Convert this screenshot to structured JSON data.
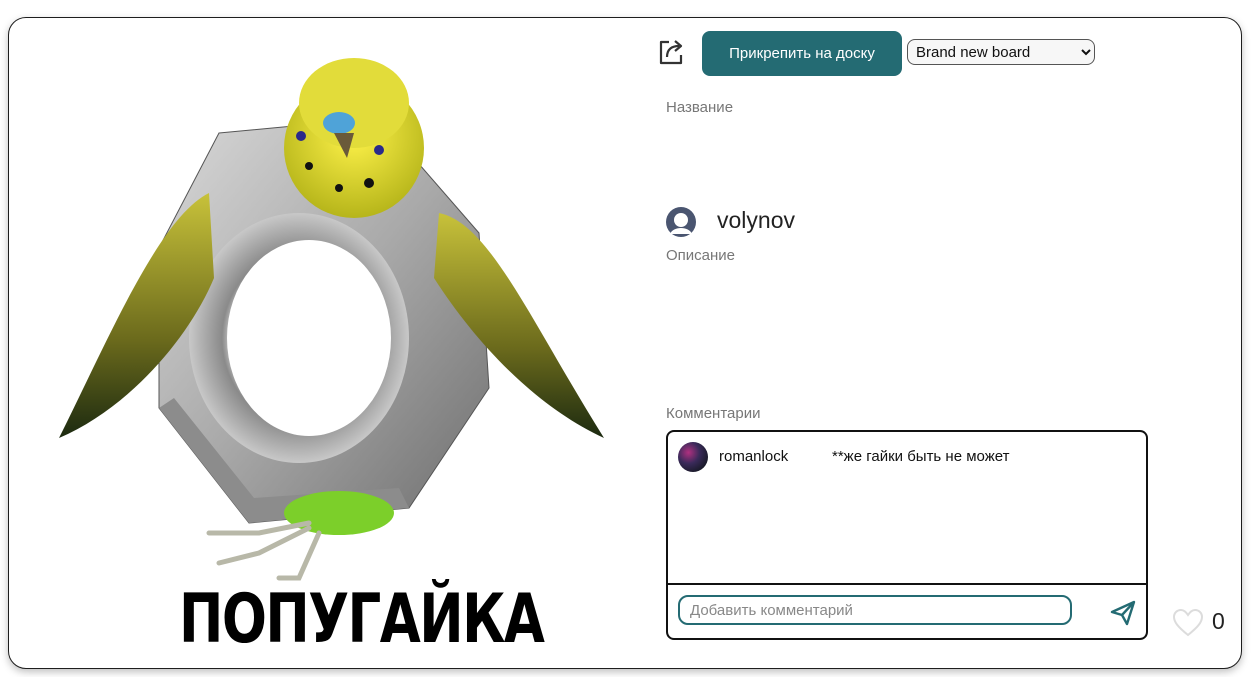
{
  "pin": {
    "image_caption": "ПОПУГАЙКА",
    "title_label": "Название",
    "description_label": "Описание",
    "author": {
      "name": "volynov",
      "avatar_icon": "user-avatar-icon"
    },
    "likes": {
      "count": "0",
      "icon": "heart-icon"
    }
  },
  "toolbar": {
    "share_icon": "share-icon",
    "pin_button_label": "Прикрепить на доску",
    "board_select": {
      "selected": "Brand new board",
      "options": [
        "Brand new board"
      ]
    }
  },
  "comments": {
    "label": "Комментарии",
    "items": [
      {
        "user": "romanlock",
        "text": "**же гайки быть не может"
      }
    ],
    "input": {
      "placeholder": "Добавить комментарий",
      "value": ""
    },
    "send_icon": "send-icon"
  },
  "colors": {
    "accent": "#246b73",
    "border": "#111111",
    "muted_text": "#777777"
  }
}
